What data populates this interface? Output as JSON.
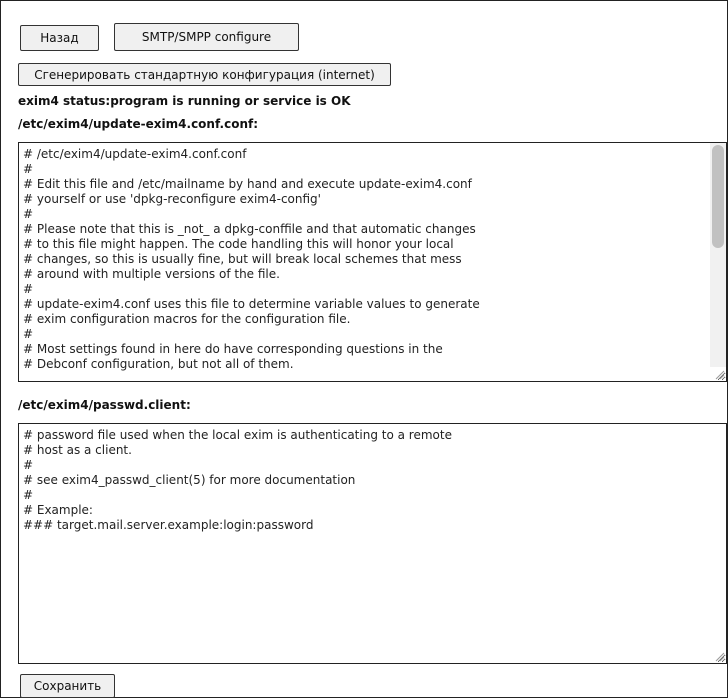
{
  "toolbar": {
    "back_label": "Назад",
    "smtp_label": "SMTP/SMPP configure",
    "generate_label": "Сгенерировать стандартную конфигурация (internet)"
  },
  "status": {
    "text": "exim4 status:program is running or service is OK"
  },
  "update_conf": {
    "path_label": "/etc/exim4/update-exim4.conf.conf:",
    "content": "# /etc/exim4/update-exim4.conf.conf\n#\n# Edit this file and /etc/mailname by hand and execute update-exim4.conf\n# yourself or use 'dpkg-reconfigure exim4-config'\n#\n# Please note that this is _not_ a dpkg-conffile and that automatic changes\n# to this file might happen. The code handling this will honor your local\n# changes, so this is usually fine, but will break local schemes that mess\n# around with multiple versions of the file.\n#\n# update-exim4.conf uses this file to determine variable values to generate\n# exim configuration macros for the configuration file.\n#\n# Most settings found in here do have corresponding questions in the\n# Debconf configuration, but not all of them."
  },
  "passwd_client": {
    "path_label": "/etc/exim4/passwd.client:",
    "content": "# password file used when the local exim is authenticating to a remote\n# host as a client.\n#\n# see exim4_passwd_client(5) for more documentation\n#\n# Example:\n### target.mail.server.example:login:password"
  },
  "footer": {
    "save_label": "Сохранить"
  }
}
